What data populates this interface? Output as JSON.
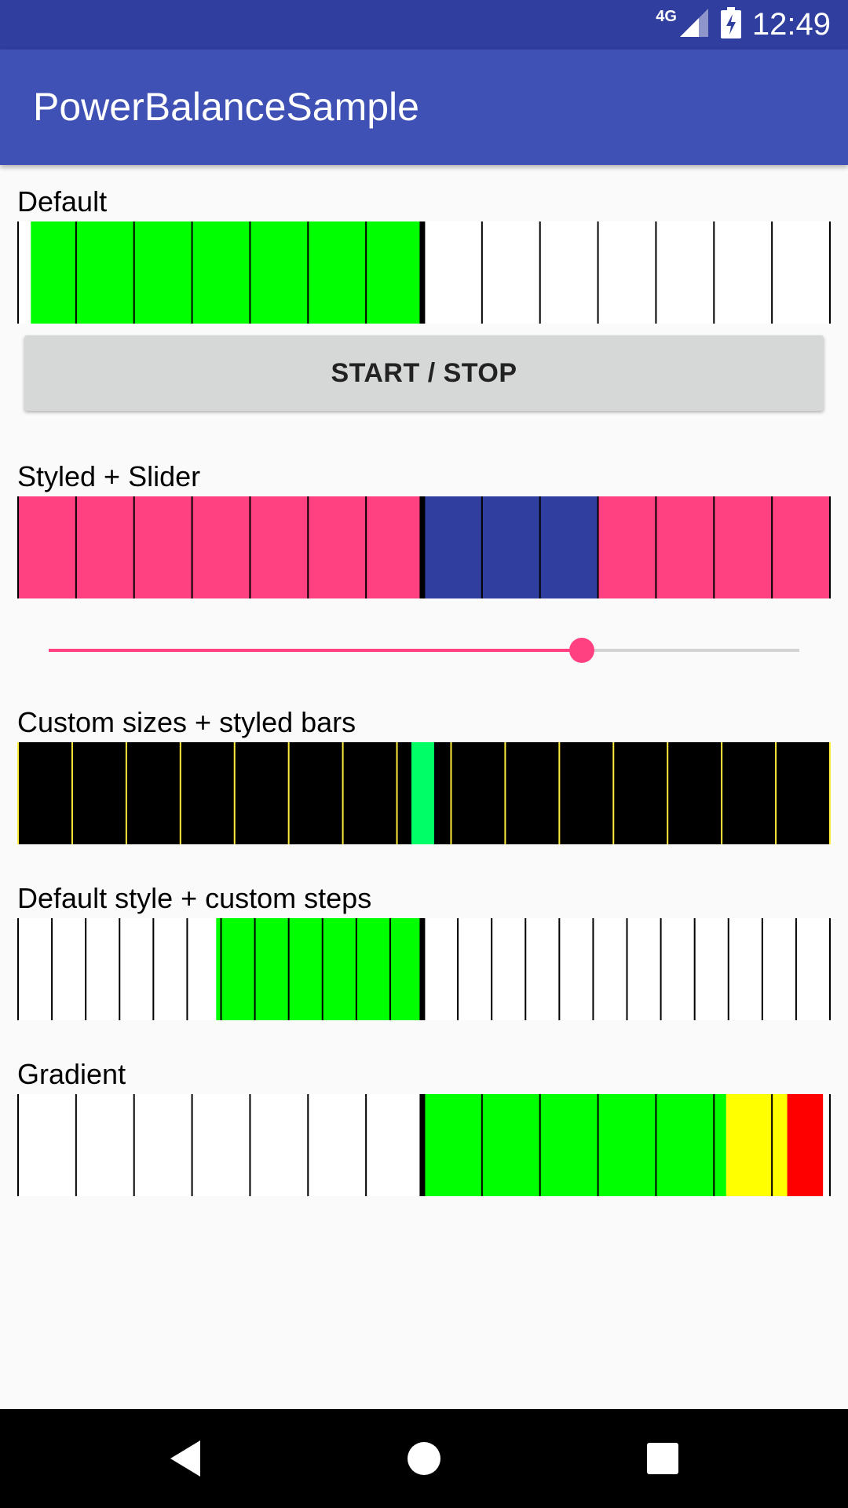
{
  "status_bar": {
    "network": "4G",
    "time": "12:49",
    "icons": [
      "signal-icon",
      "battery-charging-icon"
    ]
  },
  "app_bar": {
    "title": "PowerBalanceSample"
  },
  "colors": {
    "status_bar": "#303f9f",
    "app_bar": "#3f51b5",
    "accent": "#ff4081",
    "green": "#00ff00",
    "navy": "#303f9f",
    "spring_green": "#00ff66",
    "yellow_line": "#ffeb3b",
    "yellow": "#ffff00",
    "red": "#ff0000"
  },
  "meters": [
    {
      "label": "Default",
      "steps": 14,
      "fill_from": 0.0167,
      "fill_to": 0.4975,
      "style": "default",
      "bar_color": "#00ff00",
      "background": "#ffffff",
      "divider_color": "#000000"
    },
    {
      "label": "Styled + Slider",
      "steps": 14,
      "fill_from": 0.4975,
      "fill_to": 0.714,
      "style": "styled",
      "bar_color": "#303f9f",
      "background": "#ff4081",
      "divider_color": "#000000"
    },
    {
      "label": "Custom sizes + styled bars",
      "steps": 15,
      "fill_from": 0.4845,
      "fill_to": 0.5125,
      "style": "custom",
      "bar_color": "#00ff66",
      "background": "#000000",
      "divider_color": "#ffeb3b"
    },
    {
      "label": "Default style + custom steps",
      "steps": 24,
      "fill_from": 0.2445,
      "fill_to": 0.4975,
      "style": "default",
      "bar_color": "#00ff00",
      "background": "#ffffff",
      "divider_color": "#000000"
    },
    {
      "label": "Gradient",
      "steps": 14,
      "fill_from": 0.4975,
      "fill_to": 0.9905,
      "style": "gradient",
      "gradient": [
        {
          "to": 0.8715,
          "color": "#00ff00"
        },
        {
          "to": 0.9465,
          "color": "#ffff00"
        },
        {
          "to": 0.9905,
          "color": "#ff0000"
        }
      ],
      "background": "#ffffff",
      "divider_color": "#000000"
    }
  ],
  "button": {
    "label": "START / STOP"
  },
  "slider": {
    "value": 0.71
  },
  "nav_bar": {
    "items": [
      "back-icon",
      "home-icon",
      "recents-icon"
    ]
  }
}
